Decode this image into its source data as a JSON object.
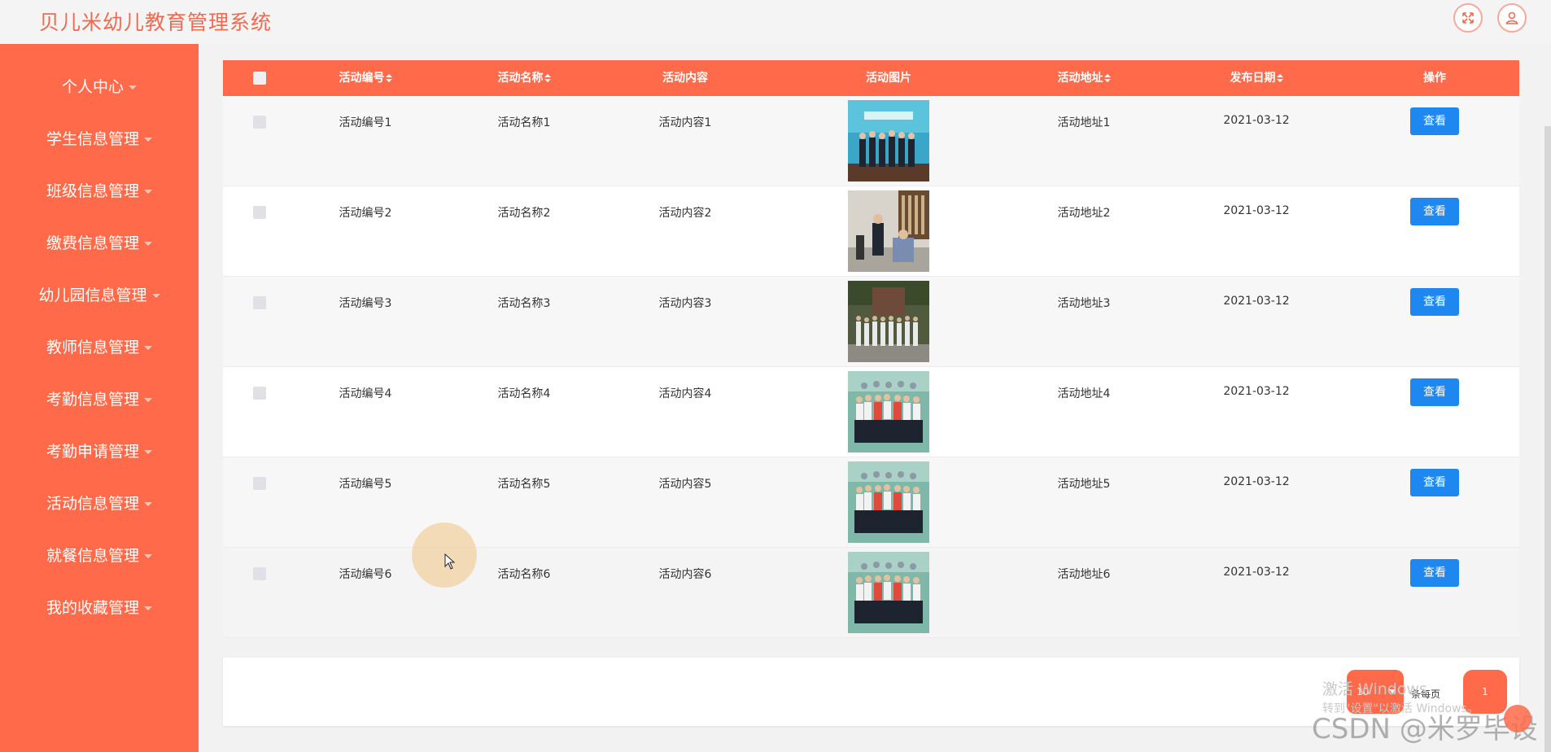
{
  "app": {
    "title": "贝儿米幼儿教育管理系统"
  },
  "header_icons": [
    "fullscreen-icon",
    "user-icon"
  ],
  "sidebar": {
    "items": [
      {
        "label": "个人中心"
      },
      {
        "label": "学生信息管理"
      },
      {
        "label": "班级信息管理"
      },
      {
        "label": "缴费信息管理"
      },
      {
        "label": "幼儿园信息管理"
      },
      {
        "label": "教师信息管理"
      },
      {
        "label": "考勤信息管理"
      },
      {
        "label": "考勤申请管理"
      },
      {
        "label": "活动信息管理"
      },
      {
        "label": "就餐信息管理"
      },
      {
        "label": "我的收藏管理"
      }
    ]
  },
  "table": {
    "headers": {
      "code": "活动编号",
      "name": "活动名称",
      "content": "活动内容",
      "image": "活动图片",
      "address": "活动地址",
      "date": "发布日期",
      "action": "操作"
    },
    "rows": [
      {
        "code": "活动编号1",
        "name": "活动名称1",
        "content": "活动内容1",
        "address": "活动地址1",
        "date": "2021-03-12",
        "action": "查看"
      },
      {
        "code": "活动编号2",
        "name": "活动名称2",
        "content": "活动内容2",
        "address": "活动地址2",
        "date": "2021-03-12",
        "action": "查看"
      },
      {
        "code": "活动编号3",
        "name": "活动名称3",
        "content": "活动内容3",
        "address": "活动地址3",
        "date": "2021-03-12",
        "action": "查看"
      },
      {
        "code": "活动编号4",
        "name": "活动名称4",
        "content": "活动内容4",
        "address": "活动地址4",
        "date": "2021-03-12",
        "action": "查看"
      },
      {
        "code": "活动编号5",
        "name": "活动名称5",
        "content": "活动内容5",
        "address": "活动地址5",
        "date": "2021-03-12",
        "action": "查看"
      },
      {
        "code": "活动编号6",
        "name": "活动名称6",
        "content": "活动内容6",
        "address": "活动地址6",
        "date": "2021-03-12",
        "action": "查看"
      }
    ]
  },
  "pagination": {
    "page_size": "10",
    "per_page_label": "条每页",
    "current_page": "1"
  },
  "watermarks": {
    "windows_line1": "激活 Windows",
    "windows_line2": "转到\"设置\"以激活 Windows。",
    "csdn": "CSDN @米罗毕设"
  },
  "colors": {
    "accent": "#ff6a4a",
    "title": "#f06a4f",
    "button": "#1e88f0"
  }
}
